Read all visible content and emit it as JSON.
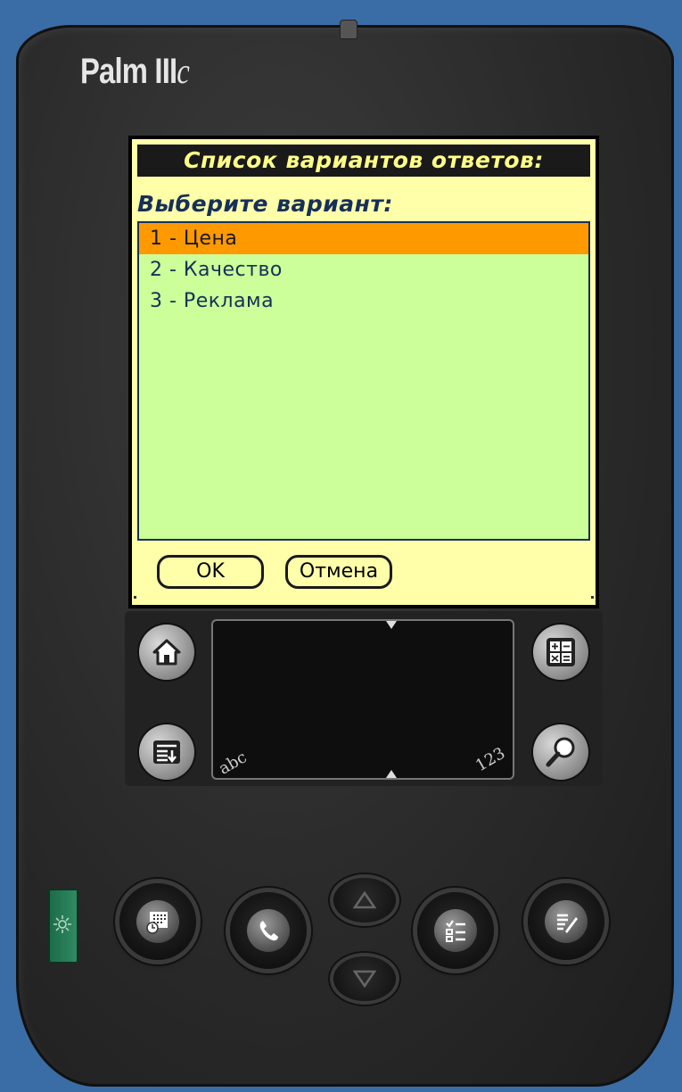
{
  "device": {
    "brand": "Palm III",
    "brand_suffix": "c"
  },
  "dialog": {
    "title": "Список вариантов ответов:",
    "prompt": "Выберите вариант:",
    "options": [
      {
        "label": "1 - Цена",
        "selected": true
      },
      {
        "label": "2 - Качество",
        "selected": false
      },
      {
        "label": "3 - Реклама",
        "selected": false
      }
    ],
    "ok_label": "OK",
    "cancel_label": "Отмена"
  },
  "graffiti": {
    "left_label": "abc",
    "right_label": "123"
  },
  "silkscreen_icons": [
    "home-icon",
    "calculator-icon",
    "menu-icon",
    "find-icon"
  ],
  "hardware_buttons": [
    "datebook-icon",
    "address-phone-icon",
    "scroll-up-icon",
    "scroll-down-icon",
    "todo-icon",
    "memo-icon"
  ],
  "colors": {
    "screen_bg": "#ffffaa",
    "list_bg": "#ccff99",
    "selection": "#ff9900",
    "titlebar": "#1a1a1a",
    "title_text": "#ffff88",
    "text": "#16305a",
    "background": "#3a6da6"
  }
}
